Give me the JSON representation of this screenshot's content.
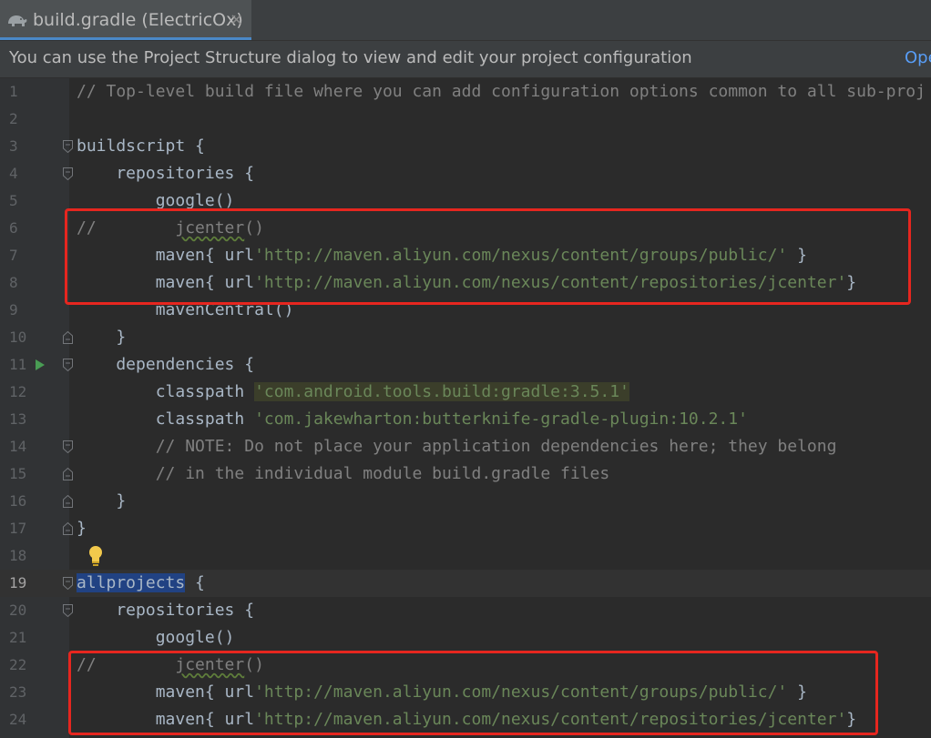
{
  "tab": {
    "title": "build.gradle (ElectricOx)",
    "close_glyph": "×",
    "icon": "gradle-elephant-icon"
  },
  "banner": {
    "text": "You can use the Project Structure dialog to view and edit your project configuration",
    "link": "Ope"
  },
  "editor": {
    "current_line": 19,
    "lines": [
      {
        "n": "1",
        "fold": "",
        "tokens": [
          {
            "t": "// Top-level build file where you can add configuration options common to all sub-proj",
            "c": "cm"
          }
        ]
      },
      {
        "n": "2",
        "fold": "",
        "tokens": []
      },
      {
        "n": "3",
        "fold": "open",
        "tokens": [
          {
            "t": "buildscript {"
          }
        ]
      },
      {
        "n": "4",
        "fold": "open",
        "tokens": [
          {
            "t": "    repositories {"
          }
        ]
      },
      {
        "n": "5",
        "fold": "",
        "tokens": [
          {
            "t": "        google()"
          }
        ]
      },
      {
        "n": "6",
        "fold": "",
        "tokens": [
          {
            "t": "//        ",
            "c": "cm"
          },
          {
            "t": "jcenter",
            "c": "cm warn"
          },
          {
            "t": "()",
            "c": "cm"
          }
        ]
      },
      {
        "n": "7",
        "fold": "",
        "tokens": [
          {
            "t": "        maven{ url"
          },
          {
            "t": "'http://maven.aliyun.com/nexus/content/groups/public/'",
            "c": "str"
          },
          {
            "t": " }"
          }
        ]
      },
      {
        "n": "8",
        "fold": "",
        "tokens": [
          {
            "t": "        maven{ url"
          },
          {
            "t": "'http://maven.aliyun.com/nexus/content/repositories/jcenter'",
            "c": "str"
          },
          {
            "t": "}"
          }
        ]
      },
      {
        "n": "9",
        "fold": "",
        "tokens": [
          {
            "t": "        mavenCentral()"
          }
        ]
      },
      {
        "n": "10",
        "fold": "close",
        "tokens": [
          {
            "t": "    }"
          }
        ]
      },
      {
        "n": "11",
        "fold": "open",
        "run": true,
        "tokens": [
          {
            "t": "    dependencies {"
          }
        ]
      },
      {
        "n": "12",
        "fold": "",
        "tokens": [
          {
            "t": "        classpath "
          },
          {
            "t": "'com.android.tools.build:gradle:3.5.1'",
            "c": "str hl"
          }
        ]
      },
      {
        "n": "13",
        "fold": "",
        "tokens": [
          {
            "t": "        classpath "
          },
          {
            "t": "'com.jakewharton:butterknife-gradle-plugin:10.2.1'",
            "c": "str"
          }
        ]
      },
      {
        "n": "14",
        "fold": "open",
        "tokens": [
          {
            "t": "        // NOTE: Do not place your application dependencies here; they belong",
            "c": "cm"
          }
        ]
      },
      {
        "n": "15",
        "fold": "close",
        "tokens": [
          {
            "t": "        // in the individual module build.gradle files",
            "c": "cm"
          }
        ]
      },
      {
        "n": "16",
        "fold": "close",
        "tokens": [
          {
            "t": "    }"
          }
        ]
      },
      {
        "n": "17",
        "fold": "close",
        "tokens": [
          {
            "t": "}"
          }
        ]
      },
      {
        "n": "18",
        "fold": "",
        "bulb": true,
        "tokens": []
      },
      {
        "n": "19",
        "fold": "open",
        "tokens": [
          {
            "t": "allprojects",
            "c": "sel"
          },
          {
            "t": " {"
          }
        ]
      },
      {
        "n": "20",
        "fold": "open",
        "tokens": [
          {
            "t": "    repositories {"
          }
        ]
      },
      {
        "n": "21",
        "fold": "",
        "tokens": [
          {
            "t": "        google()"
          }
        ]
      },
      {
        "n": "22",
        "fold": "",
        "tokens": [
          {
            "t": "//        ",
            "c": "cm"
          },
          {
            "t": "jcenter",
            "c": "cm warn"
          },
          {
            "t": "()",
            "c": "cm"
          }
        ]
      },
      {
        "n": "23",
        "fold": "",
        "tokens": [
          {
            "t": "        maven{ url"
          },
          {
            "t": "'http://maven.aliyun.com/nexus/content/groups/public/'",
            "c": "str"
          },
          {
            "t": " }"
          }
        ]
      },
      {
        "n": "24",
        "fold": "",
        "tokens": [
          {
            "t": "        maven{ url"
          },
          {
            "t": "'http://maven.aliyun.com/nexus/content/repositories/jcenter'",
            "c": "str"
          },
          {
            "t": "}"
          }
        ]
      }
    ]
  },
  "colors": {
    "background": "#2b2b2b",
    "gutter": "#313335",
    "comment": "#808080",
    "string": "#6a8759",
    "text": "#a9b7c6",
    "annotation_box": "#e6261f"
  }
}
